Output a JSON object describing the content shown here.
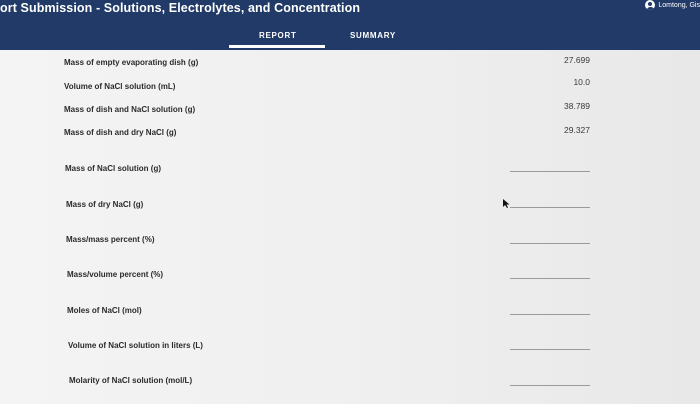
{
  "header": {
    "title": "ort Submission - Solutions, Electrolytes, and Concentration",
    "user_label": "Lomtong, Gis",
    "icons": {
      "user": "user-circle-icon",
      "cursor": "mouse-pointer-icon"
    },
    "colors": {
      "bar": "#213a67",
      "text": "#ffffff"
    }
  },
  "tabs": [
    {
      "label": "REPORT",
      "selected": true
    },
    {
      "label": "SUMMARY",
      "selected": false
    }
  ],
  "data_rows": [
    {
      "label": "Mass of empty evaporating dish (g)",
      "value": "27.699"
    },
    {
      "label": "Volume of NaCl solution (mL)",
      "value": "10.0"
    },
    {
      "label": "Mass of dish and NaCl solution (g)",
      "value": "38.789"
    },
    {
      "label": "Mass of dish and dry NaCl (g)",
      "value": "29.327"
    }
  ],
  "input_rows": [
    {
      "label": "Mass of NaCl solution (g)",
      "value": ""
    },
    {
      "label": "Mass of dry NaCl (g)",
      "value": ""
    },
    {
      "label": "Mass/mass percent (%)",
      "value": ""
    },
    {
      "label": "Mass/volume percent (%)",
      "value": ""
    },
    {
      "label": "Moles of NaCl (mol)",
      "value": ""
    },
    {
      "label": "Volume of NaCl solution in liters (L)",
      "value": ""
    },
    {
      "label": "Molarity of NaCl solution (mol/L)",
      "value": ""
    }
  ]
}
